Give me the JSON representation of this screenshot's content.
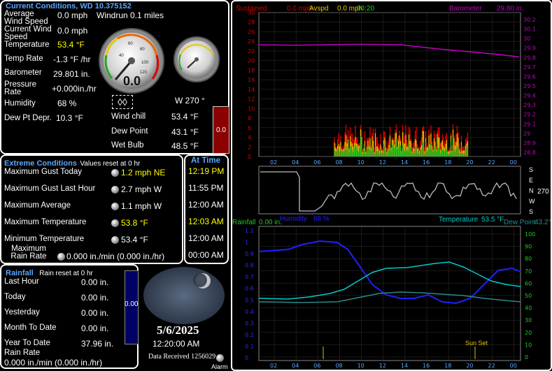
{
  "current": {
    "title": "Current Conditions, WD 10.375152",
    "avg_wind_label": "Average Wind Speed",
    "avg_wind_value": "0.0 mph",
    "windrun": "Windrun 0.1 miles",
    "cur_wind_label": "Current Wind Speed",
    "cur_wind_value": "0.0 mph",
    "temp_label": "Temperature",
    "temp_value": "53.4 °F",
    "temp_rate_label": "Temp Rate",
    "temp_rate_value": "-1.3 °F /hr",
    "baro_label": "Barometer",
    "baro_value": "29.801 in.",
    "press_rate_label": "Pressure Rate",
    "press_rate_value": "+0.000in./hr",
    "humidity_label": "Humidity",
    "humidity_value": "68 %",
    "dew_depr_label": "Dew Pt Depr.",
    "dew_depr_value": "10.3 °F",
    "wind_dir_value": "W  270 °",
    "windchill_label": "Wind chill",
    "windchill_value": "53.4 °F",
    "dewpoint_label": "Dew Point",
    "dewpoint_value": "43.1 °F",
    "wetbulb_label": "Wet Bulb",
    "wetbulb_value": "48.5 °F",
    "rain_gauge_value": "0.0",
    "gauge_display": "0.0",
    "gauge_ticks": [
      "20",
      "40",
      "60",
      "80",
      "100",
      "120",
      "0"
    ]
  },
  "extreme": {
    "title": "Extreme Conditions",
    "reset_note": "Values reset at 0 hr",
    "rows": [
      {
        "label": "Maximum Gust Today",
        "value": "1.2 mph  NE",
        "time": "12:19 PM",
        "hl": true
      },
      {
        "label": "Maximum Gust Last Hour",
        "value": "2.7 mph  W",
        "time": "11:55 PM",
        "hl": false
      },
      {
        "label": "Maximum Average",
        "value": "1.1 mph  W",
        "time": "12:00 AM",
        "hl": false
      },
      {
        "label": "Maximum Temperature",
        "value": "53.8 °F",
        "time": "12:03 AM",
        "hl": true
      },
      {
        "label": "Minimum Temperature",
        "value": "53.4 °F",
        "time": "12:00 AM",
        "hl": false
      },
      {
        "label": "Maximum Rain Rate",
        "value": "0.000 in./min (0.000 in./hr)",
        "time": "00:00 AM",
        "hl": false
      }
    ],
    "at_time_title": "At Time"
  },
  "rainfall": {
    "title": "Rainfall",
    "reset_note": "Rain reset at 0 hr",
    "rows": [
      {
        "label": "Last Hour",
        "value": "0.00 in."
      },
      {
        "label": "Today",
        "value": "0.00 in."
      },
      {
        "label": "Yesterday",
        "value": "0.00 in."
      },
      {
        "label": "Month To Date",
        "value": "0.00 in."
      },
      {
        "label": "Year To Date",
        "value": "37.96 in."
      }
    ],
    "rate_label": "Rain Rate",
    "rate_value": "0.000 in./min (0.000 in./hr)",
    "bar_value": "0.00"
  },
  "moon": {
    "date": "5/6/2025",
    "time": "12:20:00 AM",
    "data_received": "Data Received 1256029",
    "alarm": "Alarm"
  },
  "graphs": {
    "wind_header": [
      "Sustained",
      "0.0 mph",
      "Avspd",
      "0.0 mph",
      "00:20"
    ],
    "baro_header": [
      "Barometer",
      "29.80 in."
    ],
    "left_ticks": [
      "30",
      "28",
      "26",
      "24",
      "22",
      "20",
      "18",
      "16",
      "14",
      "12",
      "10",
      "8",
      "6",
      "4",
      "2",
      "0"
    ],
    "right_ticks": [
      "30.2",
      "30.1",
      "30",
      "29.9",
      "29.8",
      "29.7",
      "29.6",
      "29.5",
      "29.4",
      "29.3",
      "29.2",
      "29.1",
      "29",
      "28.9",
      "28.8"
    ],
    "hours": [
      "02",
      "04",
      "06",
      "08",
      "10",
      "12",
      "14",
      "16",
      "18",
      "20",
      "22",
      "00"
    ],
    "dir_labels": [
      "S",
      "E",
      "N",
      "W",
      "S"
    ],
    "dir_value": "270",
    "bottom_header": [
      "Rainfall",
      "0.00 in.",
      "Humidity",
      "68 %",
      "Temperature",
      "53.5 °F",
      "Dew Point",
      "43.2°"
    ],
    "rain_ticks": [
      "1.1",
      "1",
      "0.9",
      "0.8",
      "0.7",
      "0.6",
      "0.5",
      "0.4",
      "0.3",
      "0.2",
      "0.1",
      "0"
    ],
    "pct_ticks": [
      "100",
      "90",
      "80",
      "70",
      "60",
      "50",
      "40",
      "30",
      "20",
      "10",
      "0"
    ],
    "sunset": "Sun Set",
    "colors": {
      "wind_red": "#d40000",
      "wind_green": "#22cc22",
      "wind_yellow": "#e6c800",
      "baro": "#c000c0",
      "humidity": "#2020ff",
      "temp": "#00cccc",
      "dew": "#2a8a8a"
    }
  }
}
